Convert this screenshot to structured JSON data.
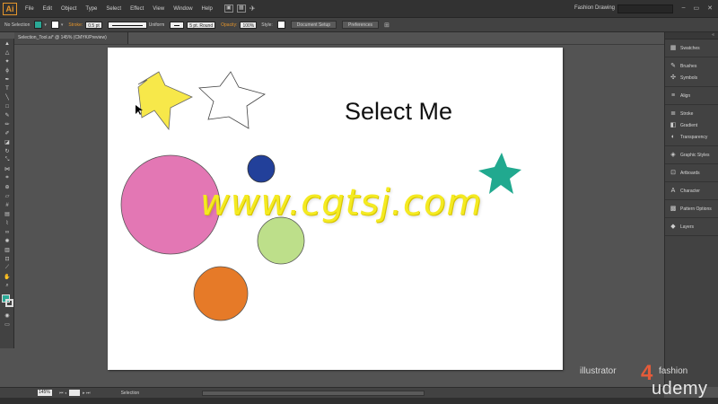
{
  "app": {
    "logo": "Ai",
    "workspace": "Fashion Drawing",
    "menus": [
      "File",
      "Edit",
      "Object",
      "Type",
      "Select",
      "Effect",
      "View",
      "Window",
      "Help"
    ]
  },
  "controlbar": {
    "selection_label": "No Selection",
    "fill_color": "#2aa996",
    "stroke_label": "Stroke:",
    "stroke_weight": "0.5 pt",
    "stroke_profile": "Uniform",
    "brush": "5 pt. Round",
    "opacity_label": "Opacity:",
    "opacity_value": "100%",
    "style_label": "Style:",
    "document_setup": "Document Setup",
    "preferences": "Preferences"
  },
  "document": {
    "tab_title": "Selection_Tool.ai* @ 145% (CMYK/Preview)",
    "artboard_text": "Select Me",
    "watermark": "www.cgtsj.com"
  },
  "shapes": {
    "star_yellow": "#f7e84a",
    "star_white": "#ffffff",
    "star_teal": "#21a98f",
    "circle_pink": "#e377b4",
    "circle_blue": "#22409a",
    "circle_green": "#bddf8a",
    "circle_orange": "#e67a28"
  },
  "panels": {
    "groups": [
      [
        {
          "icon": "swatches-icon",
          "label": "Swatches"
        }
      ],
      [
        {
          "icon": "brushes-icon",
          "label": "Brushes"
        },
        {
          "icon": "symbols-icon",
          "label": "Symbols"
        }
      ],
      [
        {
          "icon": "align-icon",
          "label": "Align"
        }
      ],
      [
        {
          "icon": "stroke-icon",
          "label": "Stroke"
        },
        {
          "icon": "gradient-icon",
          "label": "Gradient"
        },
        {
          "icon": "transparency-icon",
          "label": "Transparency"
        }
      ],
      [
        {
          "icon": "graphic-styles-icon",
          "label": "Graphic Styles"
        }
      ],
      [
        {
          "icon": "artboards-icon",
          "label": "Artboards"
        }
      ],
      [
        {
          "icon": "character-icon",
          "label": "Character"
        }
      ],
      [
        {
          "icon": "pattern-options-icon",
          "label": "Pattern Options"
        }
      ],
      [
        {
          "icon": "layers-icon",
          "label": "Layers"
        }
      ]
    ]
  },
  "statusbar": {
    "zoom": "145%",
    "page": "1",
    "status": "Selection"
  },
  "brand": {
    "illustrator": "illustrator",
    "four": "4",
    "fashion": "fashion",
    "udemy": "udemy"
  }
}
